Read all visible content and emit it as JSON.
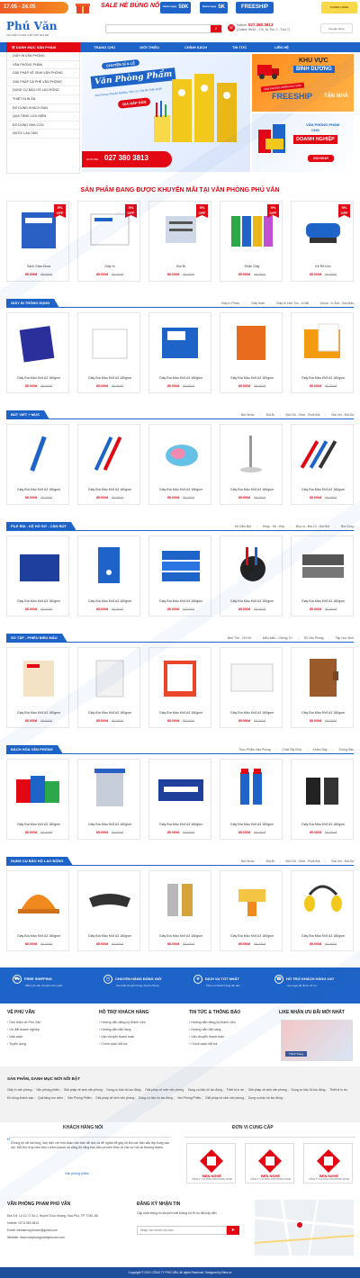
{
  "topbar": {
    "date_range": "17.05 - 24.05",
    "sale_title": "SALE HÈ BÙNG NỔ",
    "chip1_small": "Giảm ngay",
    "chip1_value": "50K",
    "chip2_small": "Giảm ngay",
    "chip2_value": "5K",
    "chip3_value": "FREESHIP",
    "gift_label": "THÁNG HÀNG"
  },
  "header": {
    "logo": "Phú Văn",
    "slogan": "CHUYÊN CUNG CẤP VPP GIÁ RẺ",
    "hotline_label": "Hotline:",
    "hotline": "027.380.3813",
    "hours": "(Online: 8h30 - 17h, từ Thứ 2 - Thứ 7)",
    "search_icon": "search-icon",
    "store_label": "Google Store"
  },
  "nav": {
    "category_label": "DANH MỤC SẢN PHẨM",
    "items": [
      "TRANG CHỦ",
      "GIỚI THIỆU",
      "CHÍNH SÁCH",
      "TIN TỨC",
      "LIÊN HỆ"
    ]
  },
  "sidebar": {
    "items": [
      "GIẤY IN VĂN PHÒNG",
      "VĂN PHÒNG PHẨM",
      "GIẢI PHÁP VỆ SINH VĂN PHÒNG",
      "GIẢI PHÁP CÀ PHÊ VĂN PHÒNG",
      "DỤNG CỤ BẢO HỘ LAO ĐỘNG",
      "THIẾT BỊ IN ẤN",
      "ĐỒ DÙNG KHÁCH SẠN",
      "QUÀ TẶNG LƯU NIỆM",
      "ĐỒ DÙNG NHÀ CỬA",
      "NƯỚC LAU SÀN"
    ]
  },
  "banner": {
    "tag": "CHUYÊN SỈ & LẺ",
    "title": "Văn Phòng Phẩm",
    "sub": "Văn Phòng Chuyên Nghiệp, Tiện Lợi, Giá Rẻ Toàn Quốc",
    "cta": "GIÁ HẤP DẪN",
    "hotline_label": "HOTLINE:",
    "hotline": "027 380 3813",
    "side1_line1": "KHU VỰC",
    "side1_line2": "BÌNH DƯƠNG",
    "side1_tag": "VĂN PHÒNG PHẨM PHÚ VĂN",
    "side1_promo": "FREESHIP",
    "side1_promo_sub": "TẬN NHÀ",
    "side2_line1": "VĂN PHÒNG PHẨM",
    "side2_line2": "CHO",
    "side2_big": "DOANH NGHIỆP",
    "side2_cta": "GỌI NGAY"
  },
  "promo": {
    "title": "SẢN PHẨM ĐANG ĐƯỢC KHUYẾN MÃI TẠI VĂN PHÒNG PHÚ VĂN",
    "badge": "5%",
    "badge_sub": "OFF",
    "products": [
      {
        "name": "Sách Giáo Khoa",
        "price": "85.000đ",
        "old": "95.000đ"
      },
      {
        "name": "Giấy In",
        "price": "85.000đ",
        "old": "95.000đ"
      },
      {
        "name": "Bút Bi",
        "price": "85.000đ",
        "old": "95.000đ"
      },
      {
        "name": "Khăn Giấy",
        "price": "85.000đ",
        "old": "95.000đ"
      },
      {
        "name": "Kệ Rổ Kéo",
        "price": "85.000đ",
        "old": "95.000đ"
      }
    ]
  },
  "categories": [
    {
      "title": "GIẤY IN THÔNG DỤNG",
      "links": [
        "Giấy In Photo",
        "Giấy Note",
        "Giấy In Liên Tục - In Bill",
        "Decal - In Ảnh - Bìa Màu"
      ],
      "products": [
        {
          "name": "Giấy Bìa Màu Khổ A3 180gsm",
          "price": "85.000đ",
          "old": "95.000đ"
        },
        {
          "name": "Giấy Bìa Màu Khổ A3 180gsm",
          "price": "85.000đ",
          "old": "95.000đ"
        },
        {
          "name": "Giấy Bìa Màu Khổ A3 180gsm",
          "price": "85.000đ",
          "old": "95.000đ"
        },
        {
          "name": "Giấy Bìa Màu Khổ A3 180gsm",
          "price": "85.000đ",
          "old": "95.000đ"
        },
        {
          "name": "Giấy Bìa Màu Khổ A3 180gsm",
          "price": "85.000đ",
          "old": "95.000đ"
        }
      ]
    },
    {
      "title": "BÚT VIẾT + MỰC",
      "links": [
        "Bút Nước",
        "Bút Bi",
        "Bút Chì - Gôm - Ruột Bút",
        "Bút Gel - Bút Dạ"
      ],
      "products": [
        {
          "name": "Giấy Bìa Màu Khổ A3 180gsm",
          "price": "85.000đ",
          "old": "95.000đ"
        },
        {
          "name": "Giấy Bìa Màu Khổ A3 180gsm",
          "price": "85.000đ",
          "old": "95.000đ"
        },
        {
          "name": "Giấy Bìa Màu Khổ A3 180gsm",
          "price": "85.000đ",
          "old": "95.000đ"
        },
        {
          "name": "Giấy Bìa Màu Khổ A3 180gsm",
          "price": "85.000đ",
          "old": "95.000đ"
        },
        {
          "name": "Giấy Bìa Màu Khổ A3 180gsm",
          "price": "85.000đ",
          "old": "95.000đ"
        }
      ]
    },
    {
      "title": "FILE BÌA - KỆ HỒ SƠ - CẮM BÚT",
      "links": [
        "Kệ Cắm Bút",
        "Khay - Kệ - Hộp",
        "Bìa Lá - Bìa Lỗ - Bìa Nút",
        "Bìa Còng"
      ],
      "products": [
        {
          "name": "Giấy Bìa Màu Khổ A3 180gsm",
          "price": "85.000đ",
          "old": "95.000đ"
        },
        {
          "name": "Giấy Bìa Màu Khổ A3 180gsm",
          "price": "85.000đ",
          "old": "95.000đ"
        },
        {
          "name": "Giấy Bìa Màu Khổ A3 180gsm",
          "price": "85.000đ",
          "old": "95.000đ"
        },
        {
          "name": "Giấy Bìa Màu Khổ A3 180gsm",
          "price": "85.000đ",
          "old": "95.000đ"
        },
        {
          "name": "Giấy Bìa Màu Khổ A3 180gsm",
          "price": "85.000đ",
          "old": "95.000đ"
        }
      ]
    },
    {
      "title": "SỔ TẬP - PHIẾU BIỂU MẪU",
      "links": [
        "Bao Thư - Hồ Sơ",
        "Biểu Mẫu - Chứng Từ",
        "Sổ Văn Phòng",
        "Tập Học Sinh"
      ],
      "products": [
        {
          "name": "Giấy Bìa Màu Khổ A3 180gsm",
          "price": "85.000đ",
          "old": "95.000đ"
        },
        {
          "name": "Giấy Bìa Màu Khổ A3 180gsm",
          "price": "85.000đ",
          "old": "95.000đ"
        },
        {
          "name": "Giấy Bìa Màu Khổ A3 180gsm",
          "price": "85.000đ",
          "old": "95.000đ"
        },
        {
          "name": "Giấy Bìa Màu Khổ A3 180gsm",
          "price": "85.000đ",
          "old": "95.000đ"
        },
        {
          "name": "Giấy Bìa Màu Khổ A3 180gsm",
          "price": "85.000đ",
          "old": "95.000đ"
        }
      ]
    },
    {
      "title": "BÁCH HÓA VĂN PHÒNG",
      "links": [
        "Thực Phẩm Văn Phòng",
        "Chất Tẩy Rửa",
        "Khăn Giấy",
        "Thùng Rác"
      ],
      "products": [
        {
          "name": "Giấy Bìa Màu Khổ A3 180gsm",
          "price": "85.000đ",
          "old": "95.000đ"
        },
        {
          "name": "Giấy Bìa Màu Khổ A3 180gsm",
          "price": "85.000đ",
          "old": "95.000đ"
        },
        {
          "name": "Giấy Bìa Màu Khổ A3 180gsm",
          "price": "85.000đ",
          "old": "95.000đ"
        },
        {
          "name": "Giấy Bìa Màu Khổ A3 180gsm",
          "price": "85.000đ",
          "old": "95.000đ"
        },
        {
          "name": "Giấy Bìa Màu Khổ A3 180gsm",
          "price": "85.000đ",
          "old": "95.000đ"
        }
      ]
    },
    {
      "title": "DỤNG CỤ BẢO HỘ LAO ĐỘNG",
      "links": [
        "Bút Nước",
        "Bút Bi",
        "Bút Chì - Gôm - Ruột Bút",
        "Bút Gel - Bút Dạ"
      ],
      "products": [
        {
          "name": "Giấy Bìa Màu Khổ A3 180gsm",
          "price": "85.000đ",
          "old": "95.000đ"
        },
        {
          "name": "Giấy Bìa Màu Khổ A3 180gsm",
          "price": "85.000đ",
          "old": "95.000đ"
        },
        {
          "name": "Giấy Bìa Màu Khổ A3 180gsm",
          "price": "85.000đ",
          "old": "95.000đ"
        },
        {
          "name": "Giấy Bìa Màu Khổ A3 180gsm",
          "price": "85.000đ",
          "old": "95.000đ"
        },
        {
          "name": "Giấy Bìa Màu Khổ A3 180gsm",
          "price": "85.000đ",
          "old": "95.000đ"
        }
      ]
    }
  ],
  "services": [
    {
      "title": "FREE SHIPPING",
      "sub": "Miễn phí vận chuyển toàn quốc",
      "icon": "truck-icon"
    },
    {
      "title": "CHUYỂN HÀNG ĐÚNG GIỜ",
      "sub": "Cam kết chuyển hàng nhanh chóng",
      "icon": "clock-icon"
    },
    {
      "title": "DỊCH VỤ TỐT NHẤT",
      "sub": "Phục vụ khách hàng tận tâm",
      "icon": "star-icon"
    },
    {
      "title": "HỖ TRỢ KHÁCH HÀNG 24/7",
      "sub": "Gọi ngay để được hỗ trợ",
      "icon": "headset-icon"
    }
  ],
  "footer_cols": [
    {
      "title": "VỀ PHÚ VĂN",
      "items": [
        "Giới thiệu về Phú Văn",
        "Ưu đãi doanh nghiệp",
        "Nhà sách",
        "Tuyển dụng"
      ]
    },
    {
      "title": "HỖ TRỢ KHÁCH HÀNG",
      "items": [
        "Hướng dẫn đăng ký thành viên",
        "Hướng dẫn đặt hàng",
        "Vận chuyển thanh toán",
        "Chính sách đổi trả"
      ]
    },
    {
      "title": "TIN TỨC & THÔNG BÁO",
      "items": [
        "Hướng dẫn đăng ký thành viên",
        "Hướng dẫn đặt hàng",
        "Vận chuyển thanh toán",
        "Chính sách đổi trả"
      ]
    }
  ],
  "facebook": {
    "title": "LIKE NHẬN ƯU ĐÃI MỚI NHẤT",
    "like_label": "Thích Trang"
  },
  "tags": {
    "title": "SẢN PHẨM, DANH MỤC MỚI NỔI BẬT",
    "items": [
      "Giấy in văn phòng",
      "Văn phòng phẩm",
      "Giải pháp vệ sinh văn phòng",
      "Dụng cụ bảo hộ lao động",
      "Giải pháp vệ sinh văn phòng",
      "Dụng cụ bảo hộ lao động",
      "Thiết bị in ấn",
      "Giải pháp vệ sinh văn phòng",
      "Dụng cụ bảo hộ lao động",
      "Thiết bị in ấn",
      "Đồ dùng khách sạn",
      "Quà tặng lưu niệm",
      "Văn Phòng Phẩm",
      "Giải pháp vệ sinh văn phòng",
      "Dụng cụ bảo hộ lao động",
      "Văn Phòng Phẩm",
      "Giải pháp vệ sinh văn phòng",
      "Dụng cụ bảo hộ lao động"
    ]
  },
  "feedback": {
    "title": "KHÁCH HÀNG NÓI",
    "quote": "Chúng tôi rất hài lòng, làm việc với một đoàn văn bản dễ dọc và dễ nghĩa để gây rối khi các bản sắc lập trung vào dội. Mỗi thứ trụy cấm bản Lorem Ipsum và cũng độ rằng bao dẫn và kiến thức từ các cơ hội và thương thành.",
    "author": "Văn phòng phẩm",
    "supplier_title": "ĐƠN VỊ CUNG CẤP",
    "supplier_name": "BẾN NGHÉ",
    "supplier_sub": "CÔNG TY CỔ PHẦN VĂN PHÒNG PHẨM"
  },
  "footer_info": {
    "title": "VĂN PHÒNG PHẨM PHÚ VĂN",
    "address": "Địa Chỉ: Lô 10, Ô Số 2, Huỳnh Thúc Kháng, Hòa Phú, TP. TDM, BD",
    "hotline": "Hotline: 0274 380 3813",
    "email": "Email: vietnamvpphuvan@gmail.com",
    "website": "Website: www.vanphongphamphuvan.com",
    "newsletter_title": "ĐĂNG KÝ NHẬN TIN",
    "newsletter_sub": "Cập nhật thông tin khuyến mãi không bỏ lỡ ưu đãi hấp dẫn",
    "newsletter_placeholder": "Nhập vào email của bạn"
  },
  "copyright": "Copyright © 2021 CÔNG TY PHÚ VĂN. All rights Reserved. Designed by Nina.vn"
}
